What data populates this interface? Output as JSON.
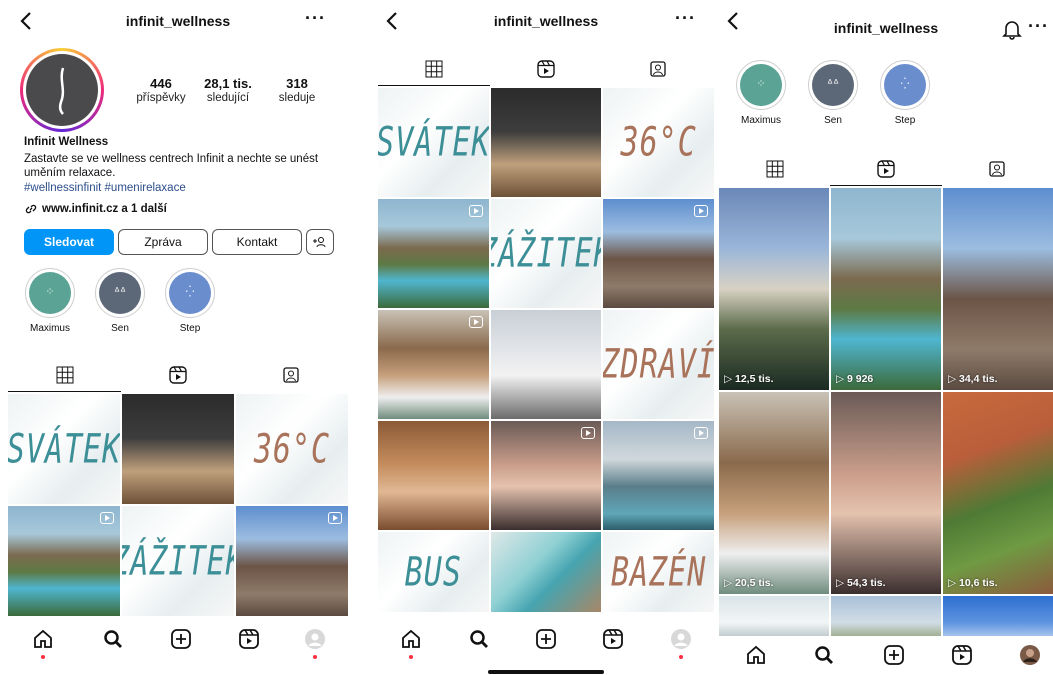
{
  "colors": {
    "accent": "#0095f6",
    "hashtag": "#2b4e8c",
    "notification_dot": "#ff3040"
  },
  "panel1": {
    "username": "infinit_wellness",
    "more": "···",
    "stats": [
      {
        "num": "446",
        "label": "příspěvky"
      },
      {
        "num": "28,1 tis.",
        "label": "sledující"
      },
      {
        "num": "318",
        "label": "sleduje"
      }
    ],
    "bio_name": "Infinit Wellness",
    "bio_text": "Zastavte se ve wellness centrech Infinit a nechte se unést uměním relaxace.",
    "bio_tags": "#wellnessinfinit #umenirelaxace",
    "bio_link": "www.infinit.cz a 1 další",
    "buttons": {
      "follow": "Sledovat",
      "message": "Zpráva",
      "contact": "Kontakt"
    },
    "highlights": [
      {
        "label": "Maximus",
        "color": "#5aa395"
      },
      {
        "label": "Sen",
        "color": "#5c6877"
      },
      {
        "label": "Step",
        "color": "#6a8dce"
      }
    ],
    "tiles": [
      "SVÁTEK",
      "",
      "36°C",
      "",
      "ZÁŽITEK",
      ""
    ]
  },
  "panel2": {
    "username": "infinit_wellness",
    "more": "···",
    "tiles": [
      "SVÁTEK",
      "",
      "36°C",
      "",
      "ZÁŽITEK",
      "",
      "",
      "",
      "ZDRAVÍ",
      "",
      "",
      "",
      "BUS",
      "",
      "BAZÉN"
    ]
  },
  "panel3": {
    "username": "infinit_wellness",
    "more": "···",
    "highlights": [
      {
        "label": "Maximus",
        "color": "#5aa395"
      },
      {
        "label": "Sen",
        "color": "#5c6877"
      },
      {
        "label": "Step",
        "color": "#6a8dce"
      }
    ],
    "reel_views": [
      "12,5 tis.",
      "9 926",
      "34,4 tis.",
      "20,5 tis.",
      "54,3 tis.",
      "10,6 tis."
    ]
  },
  "icons": {
    "back": "chevron-left-icon",
    "more": "more-icon",
    "bell": "bell-icon",
    "grid": "grid-icon",
    "reels": "reels-icon",
    "tagged": "tagged-icon",
    "home": "home-icon",
    "search": "search-icon",
    "create": "create-icon",
    "profile": "profile-icon",
    "link": "link-icon",
    "add_user": "add-user-icon"
  }
}
